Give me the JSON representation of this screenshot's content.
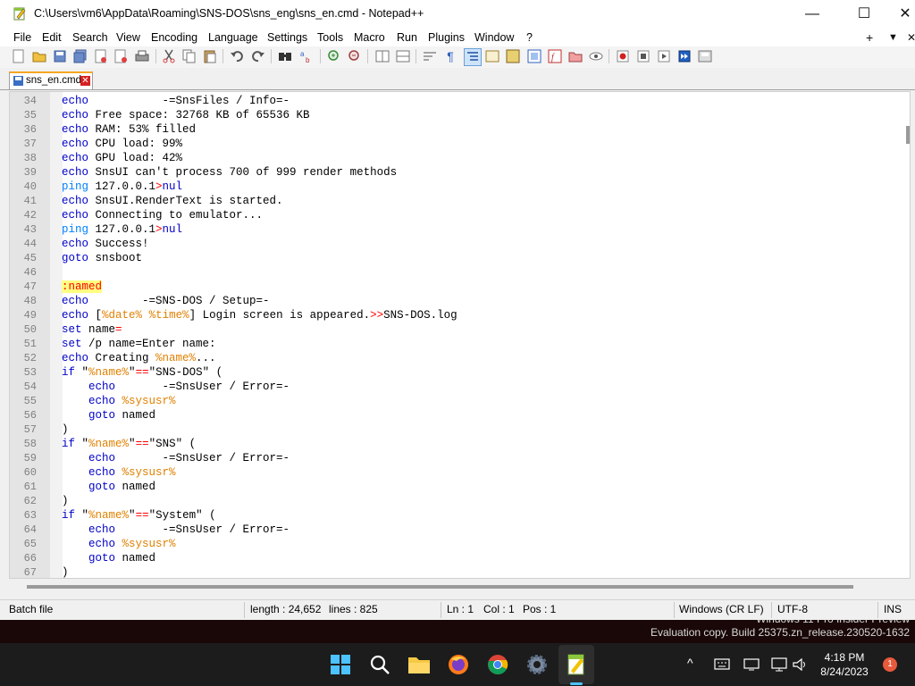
{
  "window": {
    "title": "C:\\Users\\vm6\\AppData\\Roaming\\SNS-DOS\\sns_eng\\sns_en.cmd - Notepad++",
    "minimize": "—",
    "maximize": "☐",
    "close": "✕"
  },
  "menu": [
    "File",
    "Edit",
    "Search",
    "View",
    "Encoding",
    "Language",
    "Settings",
    "Tools",
    "Macro",
    "Run",
    "Plugins",
    "Window",
    "?"
  ],
  "menu_right": {
    "plus": "+",
    "dropdown": "▼",
    "close": "✕"
  },
  "tab": {
    "label": "sns_en.cmd",
    "close": "✕"
  },
  "code_lines": [
    {
      "n": "34",
      "segs": [
        [
          "kw",
          "echo"
        ],
        [
          "",
          "           -=SnsFiles / Info=-"
        ]
      ]
    },
    {
      "n": "35",
      "segs": [
        [
          "kw",
          "echo"
        ],
        [
          "",
          " Free space: 32768 KB of 65536 KB"
        ]
      ]
    },
    {
      "n": "36",
      "segs": [
        [
          "kw",
          "echo"
        ],
        [
          "",
          " RAM: 53% filled"
        ]
      ]
    },
    {
      "n": "37",
      "segs": [
        [
          "kw",
          "echo"
        ],
        [
          "",
          " CPU load: 99%"
        ]
      ]
    },
    {
      "n": "38",
      "segs": [
        [
          "kw",
          "echo"
        ],
        [
          "",
          " GPU load: 42%"
        ]
      ]
    },
    {
      "n": "39",
      "segs": [
        [
          "kw",
          "echo"
        ],
        [
          "",
          " SnsUI can't process 700 of 999 render methods"
        ]
      ]
    },
    {
      "n": "40",
      "segs": [
        [
          "cmd",
          "ping"
        ],
        [
          "",
          " 127.0.0.1"
        ],
        [
          "op",
          ">"
        ],
        [
          "kw",
          "nul"
        ]
      ]
    },
    {
      "n": "41",
      "segs": [
        [
          "kw",
          "echo"
        ],
        [
          "",
          " SnsUI.RenderText is started."
        ]
      ]
    },
    {
      "n": "42",
      "segs": [
        [
          "kw",
          "echo"
        ],
        [
          "",
          " Connecting to emulator..."
        ]
      ]
    },
    {
      "n": "43",
      "segs": [
        [
          "cmd",
          "ping"
        ],
        [
          "",
          " 127.0.0.1"
        ],
        [
          "op",
          ">"
        ],
        [
          "kw",
          "nul"
        ]
      ]
    },
    {
      "n": "44",
      "segs": [
        [
          "kw",
          "echo"
        ],
        [
          "",
          " Success!"
        ]
      ]
    },
    {
      "n": "45",
      "segs": [
        [
          "kw",
          "goto"
        ],
        [
          "",
          " snsboot"
        ]
      ]
    },
    {
      "n": "46",
      "segs": []
    },
    {
      "n": "47",
      "segs": [
        [
          "lbl",
          ":named"
        ]
      ]
    },
    {
      "n": "48",
      "segs": [
        [
          "kw",
          "echo"
        ],
        [
          "",
          "        -=SNS-DOS / Setup=-"
        ]
      ]
    },
    {
      "n": "49",
      "segs": [
        [
          "kw",
          "echo"
        ],
        [
          "",
          " ["
        ],
        [
          "var",
          "%date%"
        ],
        [
          "",
          " "
        ],
        [
          "var",
          "%time%"
        ],
        [
          "",
          "] Login screen is appeared."
        ],
        [
          "op",
          ">>"
        ],
        [
          "",
          "SNS-DOS.log"
        ]
      ]
    },
    {
      "n": "50",
      "segs": [
        [
          "kw",
          "set"
        ],
        [
          "",
          " name"
        ],
        [
          "op",
          "="
        ]
      ]
    },
    {
      "n": "51",
      "segs": [
        [
          "kw",
          "set"
        ],
        [
          "",
          " /p name=Enter name:"
        ]
      ]
    },
    {
      "n": "52",
      "segs": [
        [
          "kw",
          "echo"
        ],
        [
          "",
          " Creating "
        ],
        [
          "var",
          "%name%"
        ],
        [
          "",
          "..."
        ]
      ]
    },
    {
      "n": "53",
      "segs": [
        [
          "kw",
          "if"
        ],
        [
          "",
          " \""
        ],
        [
          "var",
          "%name%"
        ],
        [
          "",
          "\""
        ],
        [
          "op",
          "=="
        ],
        [
          "",
          "\"SNS-DOS\" ("
        ]
      ]
    },
    {
      "n": "54",
      "segs": [
        [
          "",
          "    "
        ],
        [
          "kw",
          "echo"
        ],
        [
          "",
          "       -=SnsUser / Error=-"
        ]
      ]
    },
    {
      "n": "55",
      "segs": [
        [
          "",
          "    "
        ],
        [
          "kw",
          "echo"
        ],
        [
          "",
          " "
        ],
        [
          "var",
          "%sysusr%"
        ]
      ]
    },
    {
      "n": "56",
      "segs": [
        [
          "",
          "    "
        ],
        [
          "kw",
          "goto"
        ],
        [
          "",
          " named"
        ]
      ]
    },
    {
      "n": "57",
      "segs": [
        [
          "",
          ")"
        ]
      ]
    },
    {
      "n": "58",
      "segs": [
        [
          "kw",
          "if"
        ],
        [
          "",
          " \""
        ],
        [
          "var",
          "%name%"
        ],
        [
          "",
          "\""
        ],
        [
          "op",
          "=="
        ],
        [
          "",
          "\"SNS\" ("
        ]
      ]
    },
    {
      "n": "59",
      "segs": [
        [
          "",
          "    "
        ],
        [
          "kw",
          "echo"
        ],
        [
          "",
          "       -=SnsUser / Error=-"
        ]
      ]
    },
    {
      "n": "60",
      "segs": [
        [
          "",
          "    "
        ],
        [
          "kw",
          "echo"
        ],
        [
          "",
          " "
        ],
        [
          "var",
          "%sysusr%"
        ]
      ]
    },
    {
      "n": "61",
      "segs": [
        [
          "",
          "    "
        ],
        [
          "kw",
          "goto"
        ],
        [
          "",
          " named"
        ]
      ]
    },
    {
      "n": "62",
      "segs": [
        [
          "",
          ")"
        ]
      ]
    },
    {
      "n": "63",
      "segs": [
        [
          "kw",
          "if"
        ],
        [
          "",
          " \""
        ],
        [
          "var",
          "%name%"
        ],
        [
          "",
          "\""
        ],
        [
          "op",
          "=="
        ],
        [
          "",
          "\"System\" ("
        ]
      ]
    },
    {
      "n": "64",
      "segs": [
        [
          "",
          "    "
        ],
        [
          "kw",
          "echo"
        ],
        [
          "",
          "       -=SnsUser / Error=-"
        ]
      ]
    },
    {
      "n": "65",
      "segs": [
        [
          "",
          "    "
        ],
        [
          "kw",
          "echo"
        ],
        [
          "",
          " "
        ],
        [
          "var",
          "%sysusr%"
        ]
      ]
    },
    {
      "n": "66",
      "segs": [
        [
          "",
          "    "
        ],
        [
          "kw",
          "goto"
        ],
        [
          "",
          " named"
        ]
      ]
    },
    {
      "n": "67",
      "segs": [
        [
          "",
          ")"
        ]
      ]
    }
  ],
  "status": {
    "type": "Batch file",
    "length": "length : 24,652",
    "lines": "lines : 825",
    "ln": "Ln : 1",
    "col": "Col : 1",
    "pos": "Pos : 1",
    "eol": "Windows (CR LF)",
    "encoding": "UTF-8",
    "mode": "INS"
  },
  "watermark": {
    "line1": "Windows 11 Pro Insider Preview",
    "line2": "Evaluation copy. Build 25375.zn_release.230520-1632"
  },
  "taskbar": {
    "time": "4:18 PM",
    "date": "8/24/2023",
    "notifications": "1",
    "tray_chevron": "^"
  },
  "colors": {
    "keyword": "#0000c8",
    "command": "#0080ff",
    "variable": "#e08000",
    "operator": "#ff0000",
    "label_bg": "#ffff80",
    "tab_accent": "#f5a623"
  }
}
